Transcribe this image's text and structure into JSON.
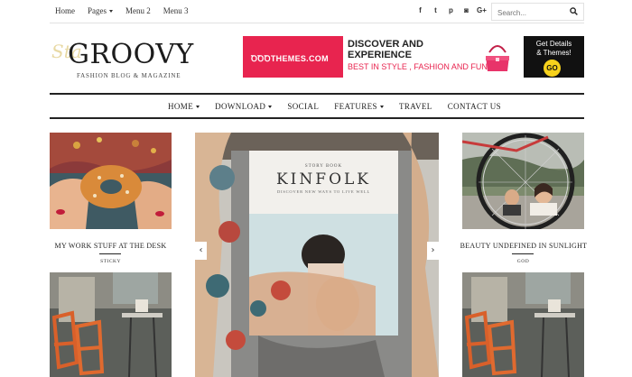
{
  "topbar": {
    "nav": [
      {
        "label": "Home",
        "dropdown": false
      },
      {
        "label": "Pages",
        "dropdown": true
      },
      {
        "label": "Menu 2",
        "dropdown": false
      },
      {
        "label": "Menu 3",
        "dropdown": false
      }
    ],
    "social": [
      {
        "icon": "facebook-icon",
        "glyph": "f"
      },
      {
        "icon": "twitter-icon",
        "glyph": "t"
      },
      {
        "icon": "pinterest-icon",
        "glyph": "p"
      },
      {
        "icon": "instagram-icon",
        "glyph": "◙"
      },
      {
        "icon": "google-plus-icon",
        "glyph": "G+"
      }
    ],
    "search_placeholder": "Search..."
  },
  "logo": {
    "script": "Sta",
    "title": "GROOVY",
    "tagline": "FASHION BLOG & MAGAZINE"
  },
  "banner": {
    "brand": "ꝹꝹꝹTHEMES.COM",
    "headline_1": "DISCOVER AND",
    "headline_2": "EXPERIENCE",
    "subline": "BEST IN STYLE , FASHION AND FUN",
    "cta_1": "Get Details",
    "cta_2": "& Themes!",
    "go": "GO",
    "colors": {
      "pink": "#e8244f",
      "yellow": "#f7d21c"
    }
  },
  "mainnav": [
    {
      "label": "HOME",
      "dropdown": true
    },
    {
      "label": "DOWNLOAD",
      "dropdown": true
    },
    {
      "label": "SOCIAL",
      "dropdown": false
    },
    {
      "label": "FEATURES",
      "dropdown": true
    },
    {
      "label": "TRAVEL",
      "dropdown": false
    },
    {
      "label": "CONTACT US",
      "dropdown": false
    }
  ],
  "posts": {
    "left_top": {
      "title": "MY WORK STUFF AT THE DESK",
      "meta": "STICKY"
    },
    "right_top": {
      "title": "BEAUTY UNDEFINED IN SUNLIGHT",
      "meta": "GOD"
    }
  },
  "slider": {
    "magazine_small": "STORY BOOK",
    "magazine_title": "KINFOLK",
    "magazine_sub": "DISCOVER NEW WAYS TO LIVE WELL",
    "prev": "‹",
    "next": "›"
  }
}
